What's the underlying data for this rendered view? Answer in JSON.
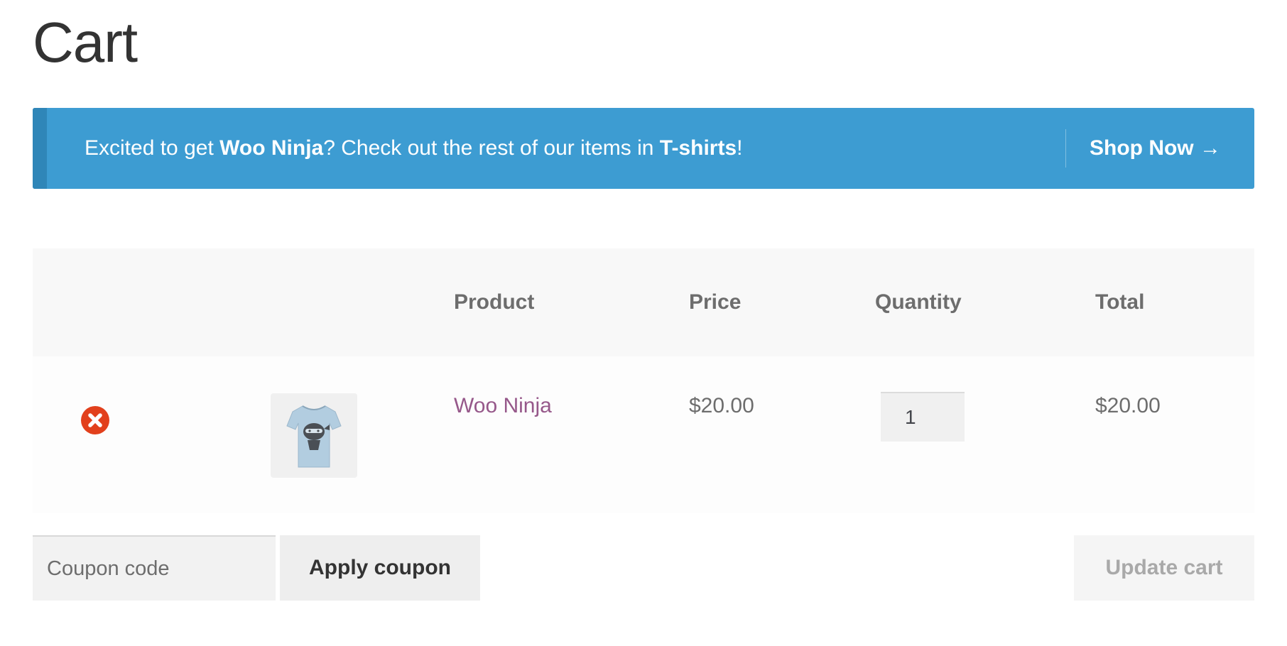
{
  "page": {
    "title": "Cart"
  },
  "notice": {
    "text_before": "Excited to get ",
    "product_name": "Woo Ninja",
    "text_middle": "? Check out the rest of our items in ",
    "category_name": "T-shirts",
    "text_after": "!",
    "link_label": "Shop Now →",
    "background_color": "#3d9cd2"
  },
  "table": {
    "headers": {
      "product": "Product",
      "price": "Price",
      "quantity": "Quantity",
      "total": "Total"
    },
    "rows": [
      {
        "remove_icon": "remove-circle-x-icon",
        "thumbnail": "ninja-tshirt-image",
        "product_name": "Woo Ninja",
        "price": "$20.00",
        "quantity": "1",
        "total": "$20.00"
      }
    ]
  },
  "actions": {
    "coupon_placeholder": "Coupon code",
    "coupon_value": "",
    "apply_label": "Apply coupon",
    "update_label": "Update cart"
  },
  "colors": {
    "product_link": "#96588a",
    "remove": "#e2401c"
  }
}
